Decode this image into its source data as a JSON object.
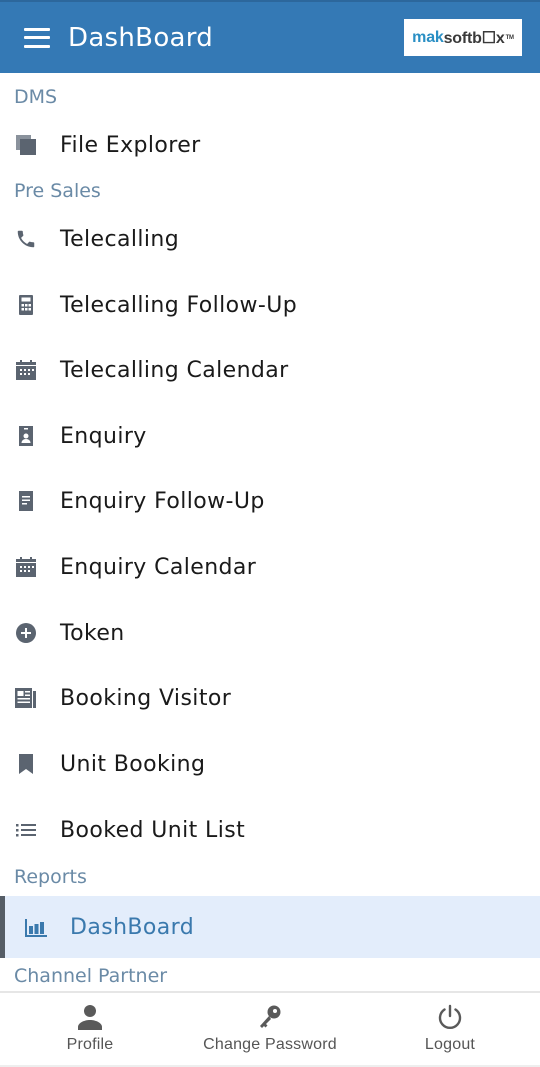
{
  "appbar": {
    "title": "DashBoard",
    "menu_icon": "hamburger-menu-icon",
    "logo": {
      "part1": "mak",
      "part2": "softb☐x",
      "tm": "TM",
      "brand_color": "#2a8fc4"
    }
  },
  "colors": {
    "appbar_bg": "#3479b5",
    "section_header": "#6a8aa6",
    "active_bg": "#e3edfb",
    "active_text": "#3a79ad",
    "icon": "#5b6470"
  },
  "drawer": {
    "sections": [
      {
        "title": "DMS",
        "items": [
          {
            "label": "File Explorer",
            "icon": "file-copy-icon"
          }
        ]
      },
      {
        "title": "Pre Sales",
        "items": [
          {
            "label": "Telecalling",
            "icon": "phone-icon"
          },
          {
            "label": "Telecalling Follow-Up",
            "icon": "calculator-icon"
          },
          {
            "label": "Telecalling Calendar",
            "icon": "calendar-icon"
          },
          {
            "label": "Enquiry",
            "icon": "contact-card-icon"
          },
          {
            "label": "Enquiry Follow-Up",
            "icon": "document-icon"
          },
          {
            "label": "Enquiry Calendar",
            "icon": "calendar-icon"
          },
          {
            "label": "Token",
            "icon": "add-circle-icon"
          },
          {
            "label": "Booking Visitor",
            "icon": "newspaper-icon"
          },
          {
            "label": "Unit Booking",
            "icon": "bookmark-icon"
          },
          {
            "label": "Booked Unit List",
            "icon": "list-icon"
          }
        ]
      },
      {
        "title": "Reports",
        "items": [
          {
            "label": "DashBoard",
            "icon": "bar-chart-icon",
            "active": true
          }
        ]
      },
      {
        "title": "Channel Partner",
        "items": []
      }
    ]
  },
  "bottom_nav": [
    {
      "label": "Profile",
      "icon": "person-icon"
    },
    {
      "label": "Change Password",
      "icon": "key-icon"
    },
    {
      "label": "Logout",
      "icon": "power-icon"
    }
  ]
}
